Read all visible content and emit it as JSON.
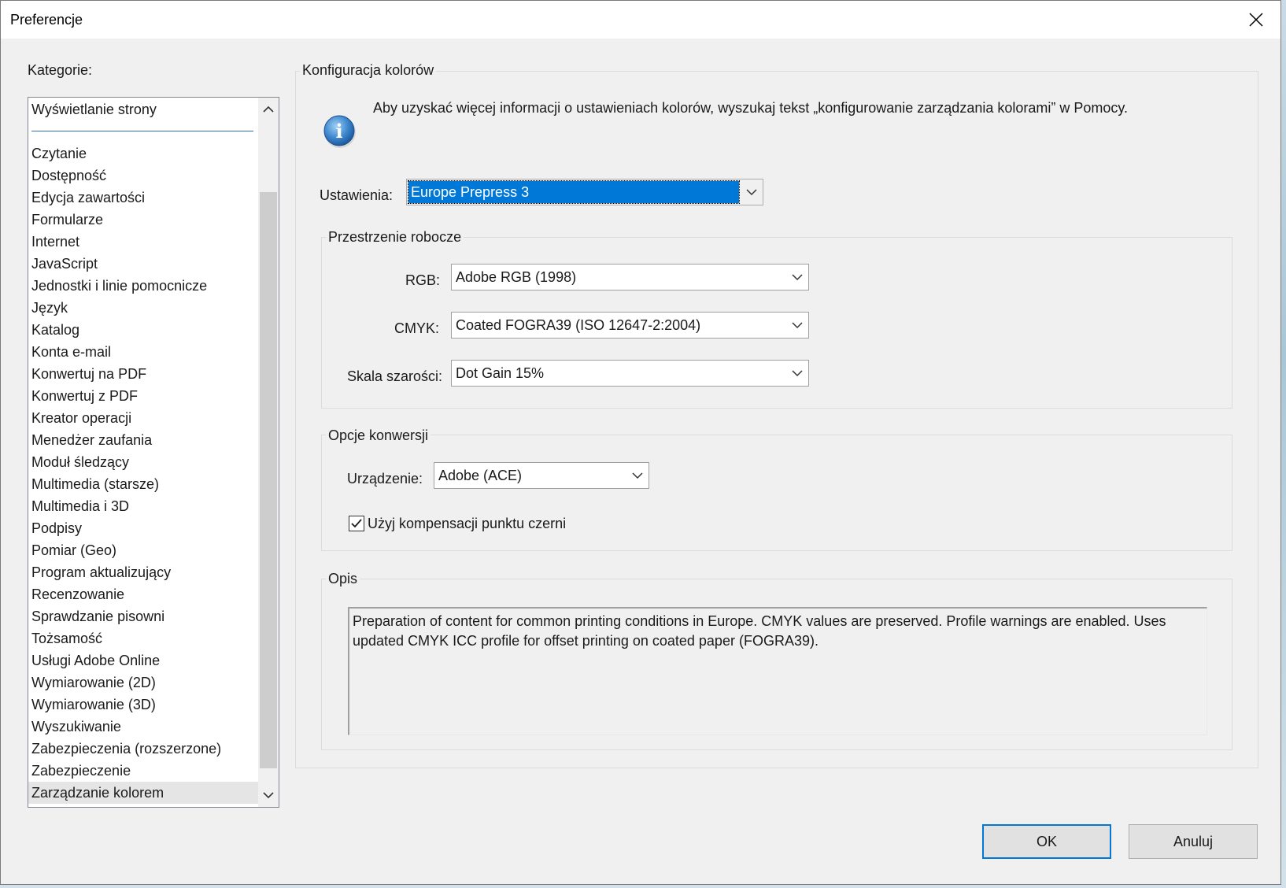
{
  "window": {
    "title": "Preferencje"
  },
  "categories": {
    "label": "Kategorie:",
    "items": [
      "Wyświetlanie strony",
      "Czytanie",
      "Dostępność",
      "Edycja zawartości",
      "Formularze",
      "Internet",
      "JavaScript",
      "Jednostki i linie pomocnicze",
      "Język",
      "Katalog",
      "Konta e-mail",
      "Konwertuj na PDF",
      "Konwertuj z PDF",
      "Kreator operacji",
      "Menedżer zaufania",
      "Moduł śledzący",
      "Multimedia (starsze)",
      "Multimedia i 3D",
      "Podpisy",
      "Pomiar (Geo)",
      "Program aktualizujący",
      "Recenzowanie",
      "Sprawdzanie pisowni",
      "Tożsamość",
      "Usługi Adobe Online",
      "Wymiarowanie (2D)",
      "Wymiarowanie (3D)",
      "Wyszukiwanie",
      "Zabezpieczenia (rozszerzone)",
      "Zabezpieczenie",
      "Zarządzanie kolorem"
    ],
    "selected": "Zarządzanie kolorem"
  },
  "color_config": {
    "title": "Konfiguracja kolorów",
    "info_text": "Aby uzyskać więcej informacji o ustawieniach kolorów, wyszukaj tekst „konfigurowanie zarządzania kolorami” w Pomocy.",
    "settings_label": "Ustawienia:",
    "settings_value": "Europe Prepress 3"
  },
  "working_spaces": {
    "title": "Przestrzenie robocze",
    "rgb_label": "RGB:",
    "rgb_value": "Adobe RGB (1998)",
    "cmyk_label": "CMYK:",
    "cmyk_value": "Coated FOGRA39 (ISO 12647-2:2004)",
    "gray_label": "Skala szarości:",
    "gray_value": "Dot Gain 15%"
  },
  "conversion": {
    "title": "Opcje konwersji",
    "engine_label": "Urządzenie:",
    "engine_value": "Adobe (ACE)",
    "bpc_label": "Użyj kompensacji punktu czerni",
    "bpc_checked": true
  },
  "description": {
    "title": "Opis",
    "text": "Preparation of content for common printing conditions in Europe. CMYK values are preserved. Profile warnings are enabled. Uses updated CMYK ICC profile for offset printing on coated paper (FOGRA39)."
  },
  "buttons": {
    "ok": "OK",
    "cancel": "Anuluj"
  },
  "colors": {
    "accent": "#0078d7",
    "dialog_bg": "#f0f0f0"
  }
}
